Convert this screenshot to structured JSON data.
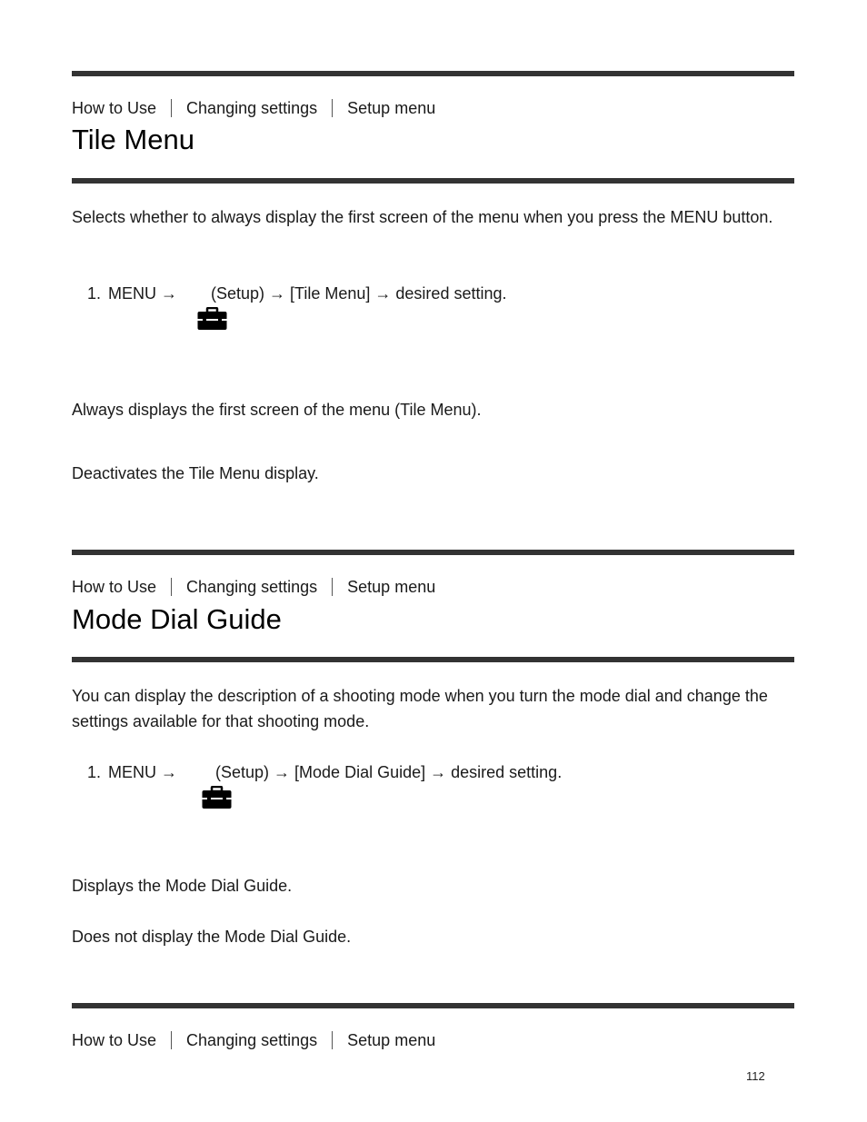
{
  "sections": [
    {
      "breadcrumb": [
        "How to Use",
        "Changing settings",
        "Setup menu"
      ],
      "title": "Tile Menu",
      "description": "Selects whether to always display the first screen of the menu when you press the MENU button.",
      "step": {
        "number": "1.",
        "prefix": "MENU →",
        "icon": "toolbox-icon",
        "suffix": "(Setup) → [Tile Menu] → desired setting."
      },
      "options": [
        "Always displays the first screen of the menu (Tile Menu).",
        "Deactivates the Tile Menu display."
      ]
    },
    {
      "breadcrumb": [
        "How to Use",
        "Changing settings",
        "Setup menu"
      ],
      "title": "Mode Dial Guide",
      "description": "You can display the description of a shooting mode when you turn the mode dial and change the settings available for that shooting mode.",
      "step": {
        "number": "1.",
        "prefix": "MENU → ",
        "icon": "toolbox-icon",
        "suffix": "(Setup) → [Mode Dial Guide] → desired setting."
      },
      "options": [
        "Displays the Mode Dial Guide.",
        "Does not display the Mode Dial Guide."
      ]
    },
    {
      "breadcrumb": [
        "How to Use",
        "Changing settings",
        "Setup menu"
      ]
    }
  ],
  "page_number": "112"
}
